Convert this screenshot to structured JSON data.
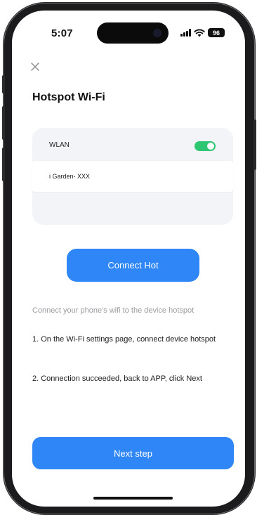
{
  "status_bar": {
    "time": "5:07",
    "battery": "96",
    "icons": [
      "cellular-signal-icon",
      "wifi-icon",
      "battery-icon"
    ]
  },
  "header": {
    "close_icon": "close-icon",
    "title": "Hotspot Wi-Fi"
  },
  "wlan_card": {
    "label": "WLAN",
    "toggle_on": true,
    "ssid": "i Garden- XXX"
  },
  "actions": {
    "connect_label": "Connect Hot",
    "next_label": "Next step"
  },
  "instructions": {
    "hint": "Connect your phone's wifi to the device hotspot",
    "step_1": "1. On the Wi-Fi settings page, connect device hotspot",
    "step_2": "2. Connection succeeded, back to APP, click Next"
  },
  "colors": {
    "accent": "#2f86f6",
    "toggle_on": "#2ec672",
    "card_bg": "#f3f4f7",
    "hint_text": "#9a9ca1"
  }
}
